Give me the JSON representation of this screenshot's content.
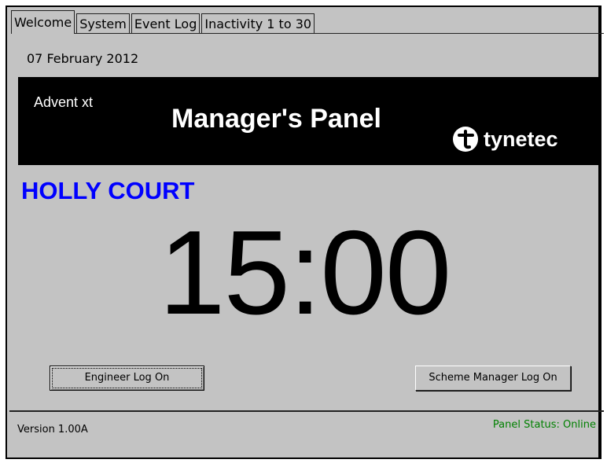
{
  "tabs": [
    {
      "label": "Welcome",
      "active": true
    },
    {
      "label": "System",
      "active": false
    },
    {
      "label": "Event Log",
      "active": false
    },
    {
      "label": "Inactivity 1 to 30",
      "active": false
    }
  ],
  "date": "07 February 2012",
  "banner": {
    "product": "Advent xt",
    "title": "Manager's Panel",
    "brand": "tynetec",
    "brand_icon": "tynetec-logo-icon"
  },
  "site_name": "HOLLY COURT",
  "clock": "15:00",
  "buttons": {
    "engineer": "Engineer Log On",
    "scheme_manager": "Scheme Manager Log On"
  },
  "footer": {
    "version": "Version 1.00A",
    "status": "Panel Status: Online"
  },
  "colors": {
    "background": "#c3c3c3",
    "site_name": "#0000ff",
    "status": "#008000",
    "banner": "#000000"
  }
}
